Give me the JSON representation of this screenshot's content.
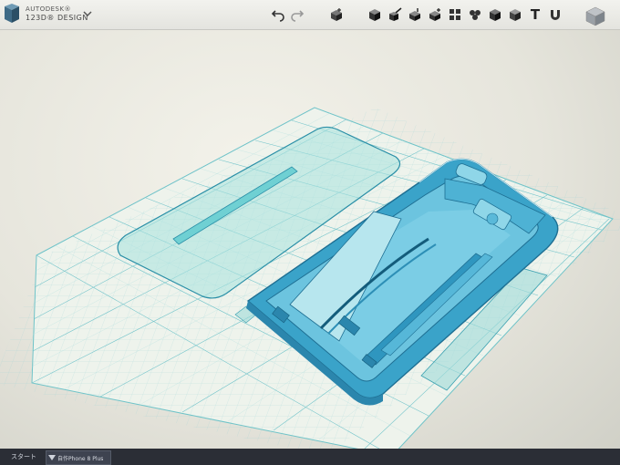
{
  "app": {
    "brand_line1": "AUTODESK®",
    "brand_line2": "123D® DESIGN"
  },
  "toolbar": {
    "undo_icon": "undo-arrow",
    "redo_icon": "redo-arrow",
    "tools": [
      "primitives",
      "sketch",
      "construct",
      "modify",
      "pattern",
      "grouping",
      "combine",
      "measure",
      "text",
      "snap",
      "material"
    ],
    "text_tool_glyph": "T"
  },
  "taskbar": {
    "start_label": "スタート",
    "task_label": "自作Phone 8 Plus"
  },
  "colors": {
    "model": "#3aa3c9",
    "model_dark": "#1e6f93",
    "ghost": "#9fdad9",
    "grid_line": "#7fc9cf",
    "toolbar_bg": "#ececE8"
  }
}
